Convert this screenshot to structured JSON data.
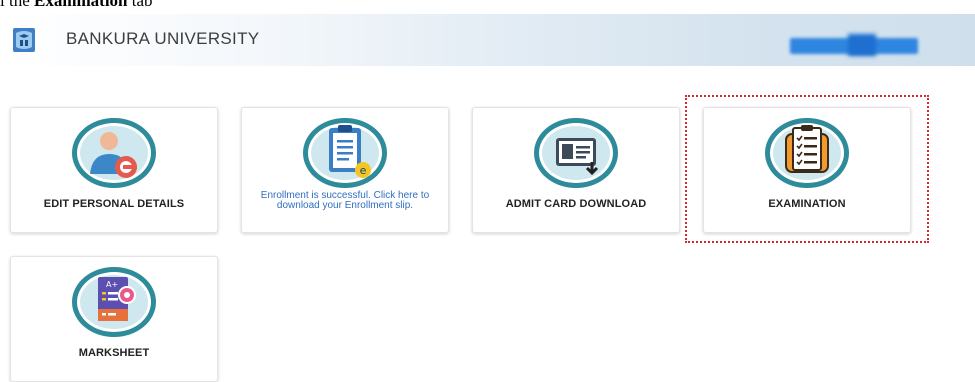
{
  "caption": {
    "prefix": "l the ",
    "bold": "Examination",
    "suffix": " tab"
  },
  "header": {
    "title": "BANKURA UNIVERSITY"
  },
  "cards": {
    "edit_personal": {
      "label": "EDIT PERSONAL DETAILS",
      "icon": "user-edit-icon"
    },
    "enrollment": {
      "note": "Enrollment is successful. Click here to download your Enrollment slip.",
      "icon": "clipboard-icon"
    },
    "admit_card": {
      "label": "ADMIT CARD DOWNLOAD",
      "icon": "id-card-download-icon"
    },
    "examination": {
      "label": "EXAMINATION",
      "icon": "exam-checklist-icon"
    },
    "marksheet": {
      "label": "MARKSHEET",
      "icon": "marksheet-icon"
    }
  },
  "colors": {
    "icon_ring": "#2e8b9a",
    "icon_fill": "#cfe7ee",
    "highlight": "#d62a2a",
    "link_text": "#2f6fbf"
  }
}
